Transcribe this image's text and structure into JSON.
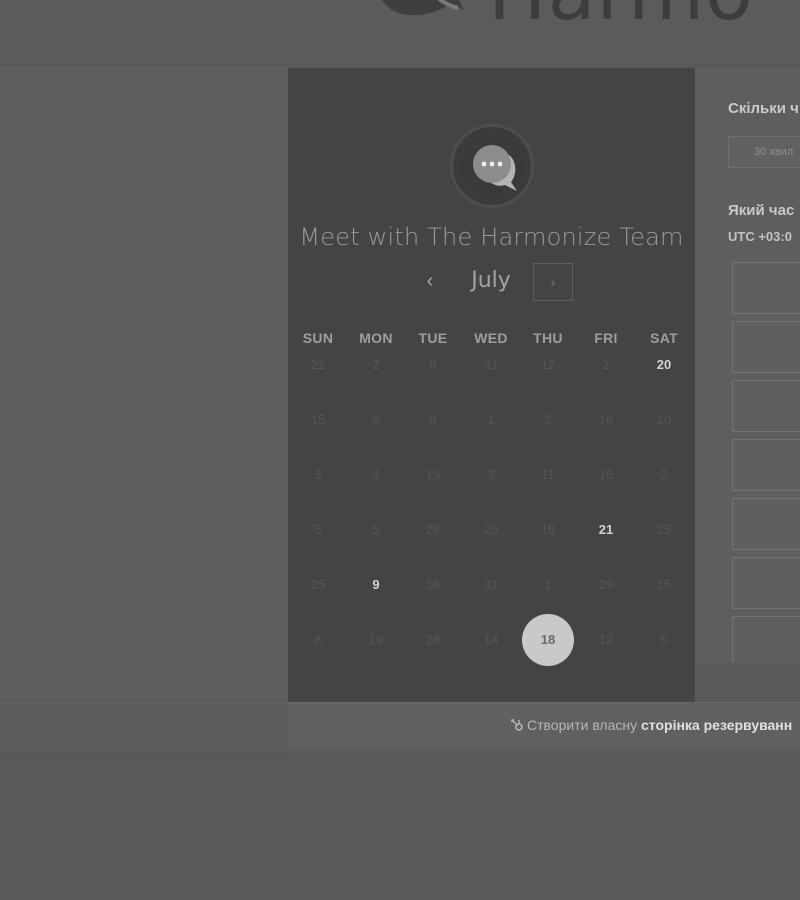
{
  "brand": {
    "name": "Harmo"
  },
  "calendar": {
    "title": "Meet with The Harmonize Team",
    "month": "July",
    "prev_label": "‹",
    "next_label": "›",
    "weekdays": [
      "SUN",
      "MON",
      "TUE",
      "WED",
      "THU",
      "FRI",
      "SAT"
    ],
    "weeks": [
      [
        {
          "d": "21"
        },
        {
          "d": "2"
        },
        {
          "d": "8"
        },
        {
          "d": "31"
        },
        {
          "d": "12"
        },
        {
          "d": "2"
        },
        {
          "d": "20",
          "s": "avail"
        }
      ],
      [
        {
          "d": "15"
        },
        {
          "d": "8"
        },
        {
          "d": "9"
        },
        {
          "d": "1"
        },
        {
          "d": "2"
        },
        {
          "d": "16"
        },
        {
          "d": "10"
        }
      ],
      [
        {
          "d": "3"
        },
        {
          "d": "4"
        },
        {
          "d": "19"
        },
        {
          "d": "3"
        },
        {
          "d": "11"
        },
        {
          "d": "16"
        },
        {
          "d": "2"
        }
      ],
      [
        {
          "d": "5"
        },
        {
          "d": "5"
        },
        {
          "d": "28"
        },
        {
          "d": "20"
        },
        {
          "d": "18"
        },
        {
          "d": "21",
          "s": "avail"
        },
        {
          "d": "25"
        }
      ],
      [
        {
          "d": "25"
        },
        {
          "d": "9",
          "s": "avail"
        },
        {
          "d": "18"
        },
        {
          "d": "31"
        },
        {
          "d": "1"
        },
        {
          "d": "29"
        },
        {
          "d": "15"
        }
      ],
      [
        {
          "d": "8"
        },
        {
          "d": "19"
        },
        {
          "d": "28"
        },
        {
          "d": "14"
        },
        {
          "d": "18",
          "s": "selected"
        },
        {
          "d": "12"
        },
        {
          "d": "5"
        }
      ]
    ]
  },
  "booking": {
    "duration_question": "Скільки ч",
    "duration_value": "30 хвил",
    "time_question": "Який час",
    "timezone": "UTC +03:0"
  },
  "footer": {
    "link_prefix": "Створити власну ",
    "link_bold": "сторінка резервуванн"
  },
  "colors": {
    "page_bg": "#595959",
    "calendar_bg": "#444444",
    "selected_day_bg": "#c9c9c9"
  },
  "icons": {
    "avatar": "chat-bubble-logo",
    "prev": "chevron-left-icon",
    "next": "chevron-right-icon",
    "footer": "hubspot-sprocket-icon"
  }
}
